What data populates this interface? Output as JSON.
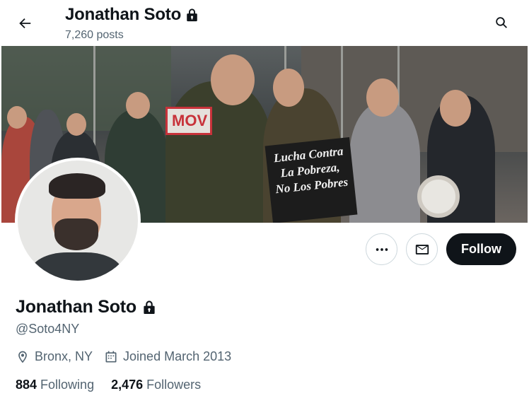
{
  "header": {
    "name": "Jonathan Soto",
    "posts_count": "7,260 posts",
    "back_icon": "arrow-left-icon",
    "search_icon": "search-icon",
    "lock_icon": "lock-icon"
  },
  "banner": {
    "sign_red_text": "MOV",
    "sign_black_lines": [
      "Lucha Contra",
      "La Pobreza,",
      "No Los Pobres"
    ]
  },
  "actions": {
    "more_icon": "more-dots-icon",
    "message_icon": "envelope-icon",
    "follow_label": "Follow"
  },
  "profile": {
    "name": "Jonathan Soto",
    "handle": "@Soto4NY",
    "location": "Bronx, NY",
    "joined": "Joined March 2013",
    "following_count": "884",
    "following_label": "Following",
    "followers_count": "2,476",
    "followers_label": "Followers"
  },
  "colors": {
    "text_primary": "#0f1419",
    "text_secondary": "#536471",
    "border": "#cfd9de",
    "follow_bg": "#0f1419"
  }
}
